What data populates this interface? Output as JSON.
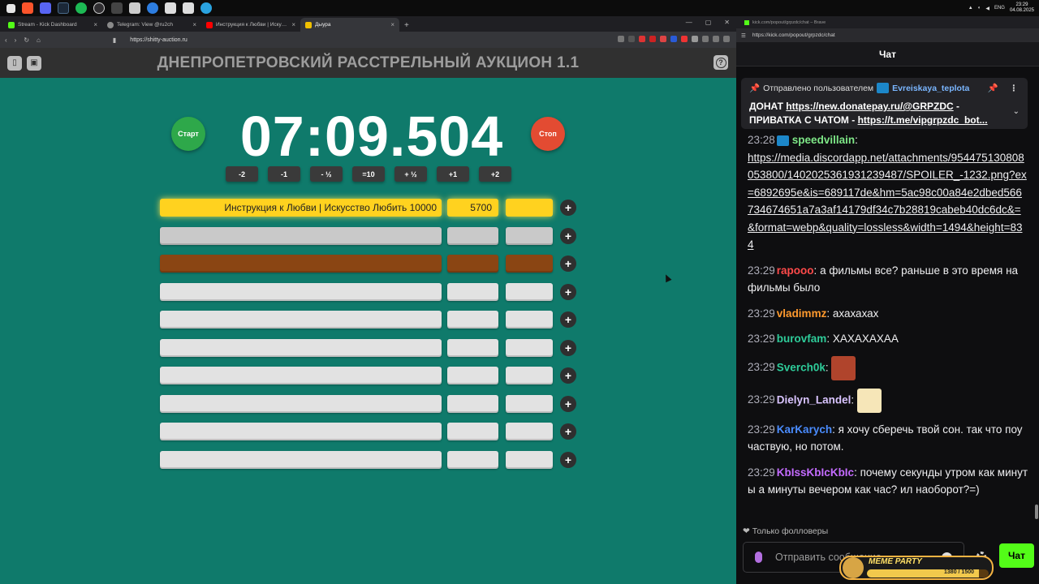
{
  "taskbar": {
    "time": "23:29",
    "date": "04.08.2025",
    "lang": "ENG"
  },
  "left_browser": {
    "tabs": [
      {
        "label": "Stream - Kick Dashboard",
        "color": "#53fc18"
      },
      {
        "label": "Telegram: View @ru2ch",
        "color": "#8a8a8a"
      },
      {
        "label": "Инструкция к Любви | Искусство Лю...",
        "color": "#ff0000"
      },
      {
        "label": "Дыура",
        "color": "#f0c000"
      }
    ],
    "url": "https://shitty-auction.ru"
  },
  "site": {
    "title": "ДНЕПРОПЕТРОВСКИЙ РАССТРЕЛЬНЫЙ АУКЦИОН 1.1",
    "start_label": "Старт",
    "stop_label": "Стоп",
    "timer": "07:09.504",
    "adjust_buttons": [
      "-2",
      "-1",
      "- ½",
      "=10",
      "+ ½",
      "+1",
      "+2"
    ],
    "lots": [
      {
        "name": "Инструкция к Любви | Искусство Любить 10000",
        "amount": "5700",
        "percent": "",
        "color": "#ffd21f"
      },
      {
        "name": "",
        "amount": "",
        "percent": "",
        "color": "#c9c9c9"
      },
      {
        "name": "",
        "amount": "",
        "percent": "",
        "color": "#8a4513"
      },
      {
        "name": "",
        "amount": "",
        "percent": "",
        "color": "#e2e2e2"
      },
      {
        "name": "",
        "amount": "",
        "percent": "",
        "color": "#e2e2e2"
      },
      {
        "name": "",
        "amount": "",
        "percent": "",
        "color": "#e2e2e2"
      },
      {
        "name": "",
        "amount": "",
        "percent": "",
        "color": "#e2e2e2"
      },
      {
        "name": "",
        "amount": "",
        "percent": "",
        "color": "#e2e2e2"
      },
      {
        "name": "",
        "amount": "",
        "percent": "",
        "color": "#e2e2e2"
      },
      {
        "name": "",
        "amount": "",
        "percent": "",
        "color": "#e2e2e2"
      }
    ],
    "add_label": "+"
  },
  "chat_browser": {
    "window_title": "kick.com/popout/grpzdc/chat – Brave",
    "url": "https://kick.com/popout/grpzdc/chat",
    "header": "Чат",
    "pinned": {
      "prefix": "Отправлено пользователем",
      "user": "Evreiskaya_teplota",
      "line1_text": "ДОНАТ",
      "line1_link": "https://new.donatepay.ru/@GRPZDC",
      "line1_sep": "-",
      "line2_text": "ПРИВАТКА С ЧАТОМ -",
      "line2_link": "https://t.me/vipgrpzdc_bot..."
    },
    "messages": [
      {
        "time": "23:28",
        "user": "speedvillain",
        "color": "#7ee787",
        "text": "",
        "link": "https://media.discordapp.net/attachments/954475130808053800/1402025361931239487/SPOILER_-1232.png?ex=6892695e&is=689117de&hm=5ac98c00a84e2dbed566734674651a7a3af14179df34c7b28819cabeb40dc6dc&=&format=webp&quality=lossless&width=1494&height=834",
        "emote": "",
        "badge": true
      },
      {
        "time": "23:29",
        "user": "rapooo",
        "color": "#ff4a4a",
        "text": "а фильмы все? раньше в это время на фильмы было",
        "link": "",
        "emote": ""
      },
      {
        "time": "23:29",
        "user": "vladimmz",
        "color": "#ff9a2e",
        "text": "ахахахах",
        "link": "",
        "emote": ""
      },
      {
        "time": "23:29",
        "user": "burovfam",
        "color": "#2ecc9a",
        "text": "ХАХАХАХАА",
        "link": "",
        "emote": ""
      },
      {
        "time": "23:29",
        "user": "Sverch0k",
        "color": "#2ecc9a",
        "text": "",
        "link": "",
        "emote": "#b0442c"
      },
      {
        "time": "23:29",
        "user": "Dielyn_Landel",
        "color": "#d9c4ff",
        "text": "",
        "link": "",
        "emote": "#f6e6b8"
      },
      {
        "time": "23:29",
        "user": "KarKarych",
        "color": "#4a8cff",
        "text": "я хочу сберечь твой сон. так что поучаствую, но потом.",
        "link": "",
        "emote": ""
      },
      {
        "time": "23:29",
        "user": "KbIssKbIcKbIc",
        "color": "#c46bff",
        "text": "почему секунды утром как минуты а минуты вечером как час? ил наоборот?=)",
        "link": "",
        "emote": ""
      }
    ],
    "followers_only": "Только фолловеры",
    "input_placeholder": "Отправить сообщение",
    "send_label": "Чат",
    "meme_party": {
      "title": "MEME PARTY",
      "count": "1380 / 1500",
      "progress": 0.92
    }
  }
}
